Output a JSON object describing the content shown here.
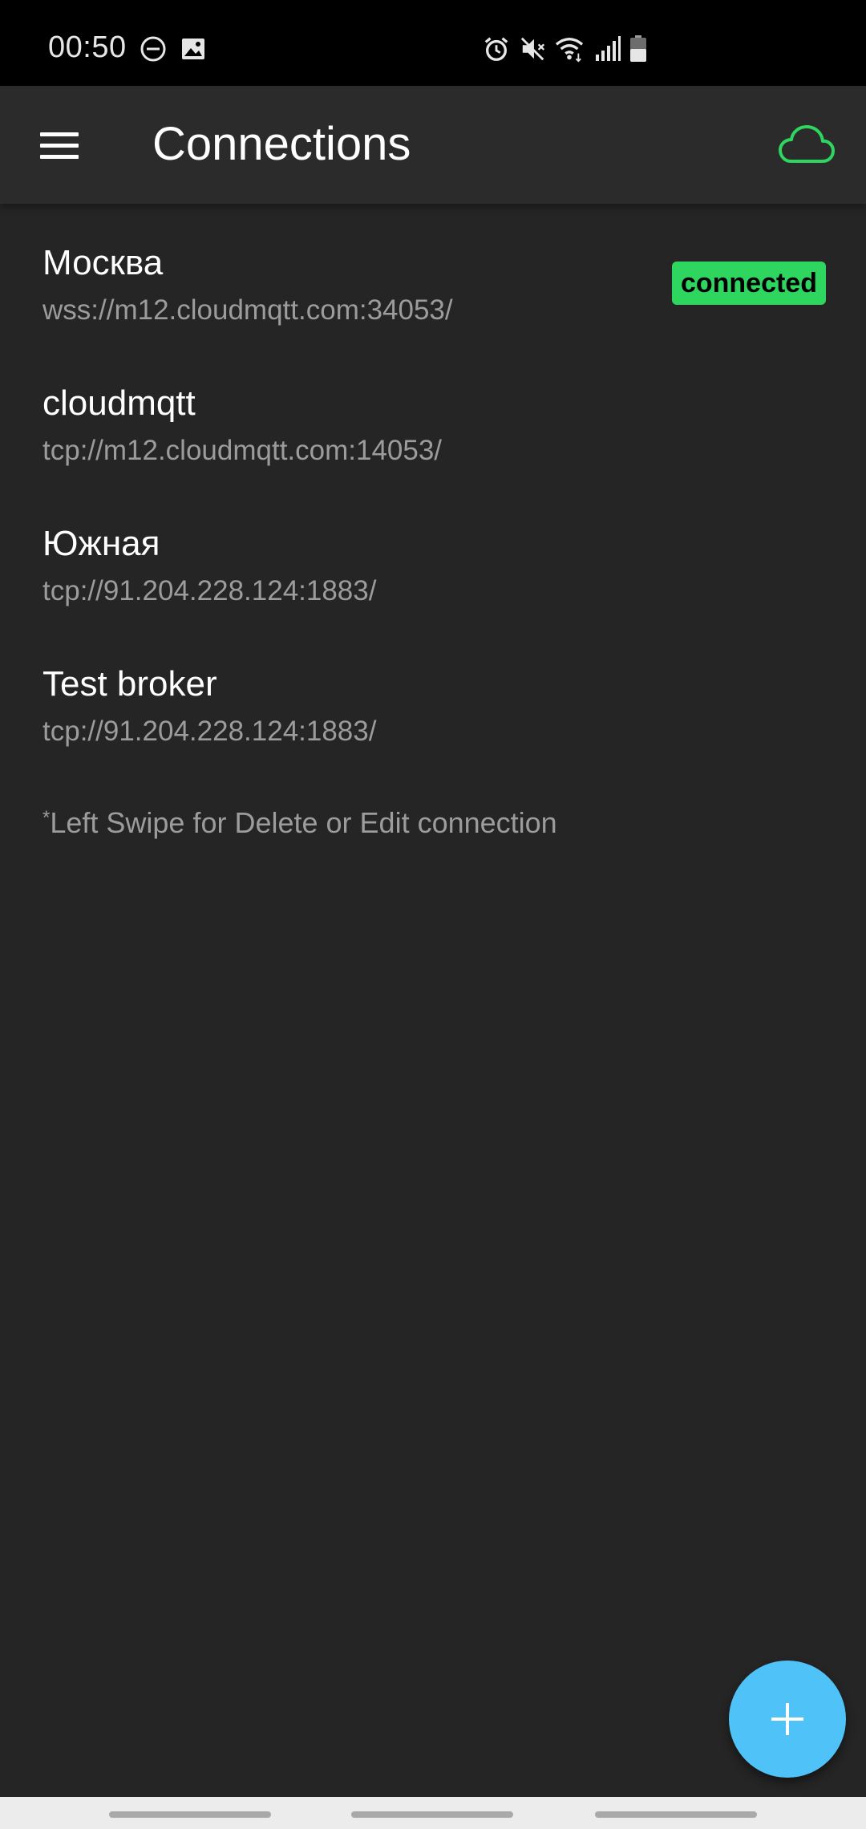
{
  "status_bar": {
    "time": "00:50",
    "icons": [
      "do-not-disturb-icon",
      "image-icon",
      "alarm-icon",
      "mute-icon",
      "wifi-icon",
      "signal-icon",
      "battery-icon"
    ]
  },
  "app_bar": {
    "title": "Connections",
    "menu_icon": "menu-icon",
    "cloud_icon": "cloud-icon",
    "cloud_color": "#2ed65f"
  },
  "connections": [
    {
      "name": "Москва",
      "url": "wss://m12.cloudmqtt.com:34053/",
      "status": "connected"
    },
    {
      "name": "cloudmqtt",
      "url": "tcp://m12.cloudmqtt.com:14053/"
    },
    {
      "name": "Южная",
      "url": "tcp://91.204.228.124:1883/"
    },
    {
      "name": "Test broker",
      "url": "tcp://91.204.228.124:1883/"
    }
  ],
  "hint": {
    "marker": "*",
    "text": "Left Swipe for Delete or Edit connection"
  },
  "fab": {
    "icon": "plus-icon",
    "color": "#4fc3f7"
  },
  "colors": {
    "background": "#252525",
    "app_bar": "#2b2b2b",
    "badge": "#2ed65f",
    "secondary_text": "#9c9c9c"
  }
}
